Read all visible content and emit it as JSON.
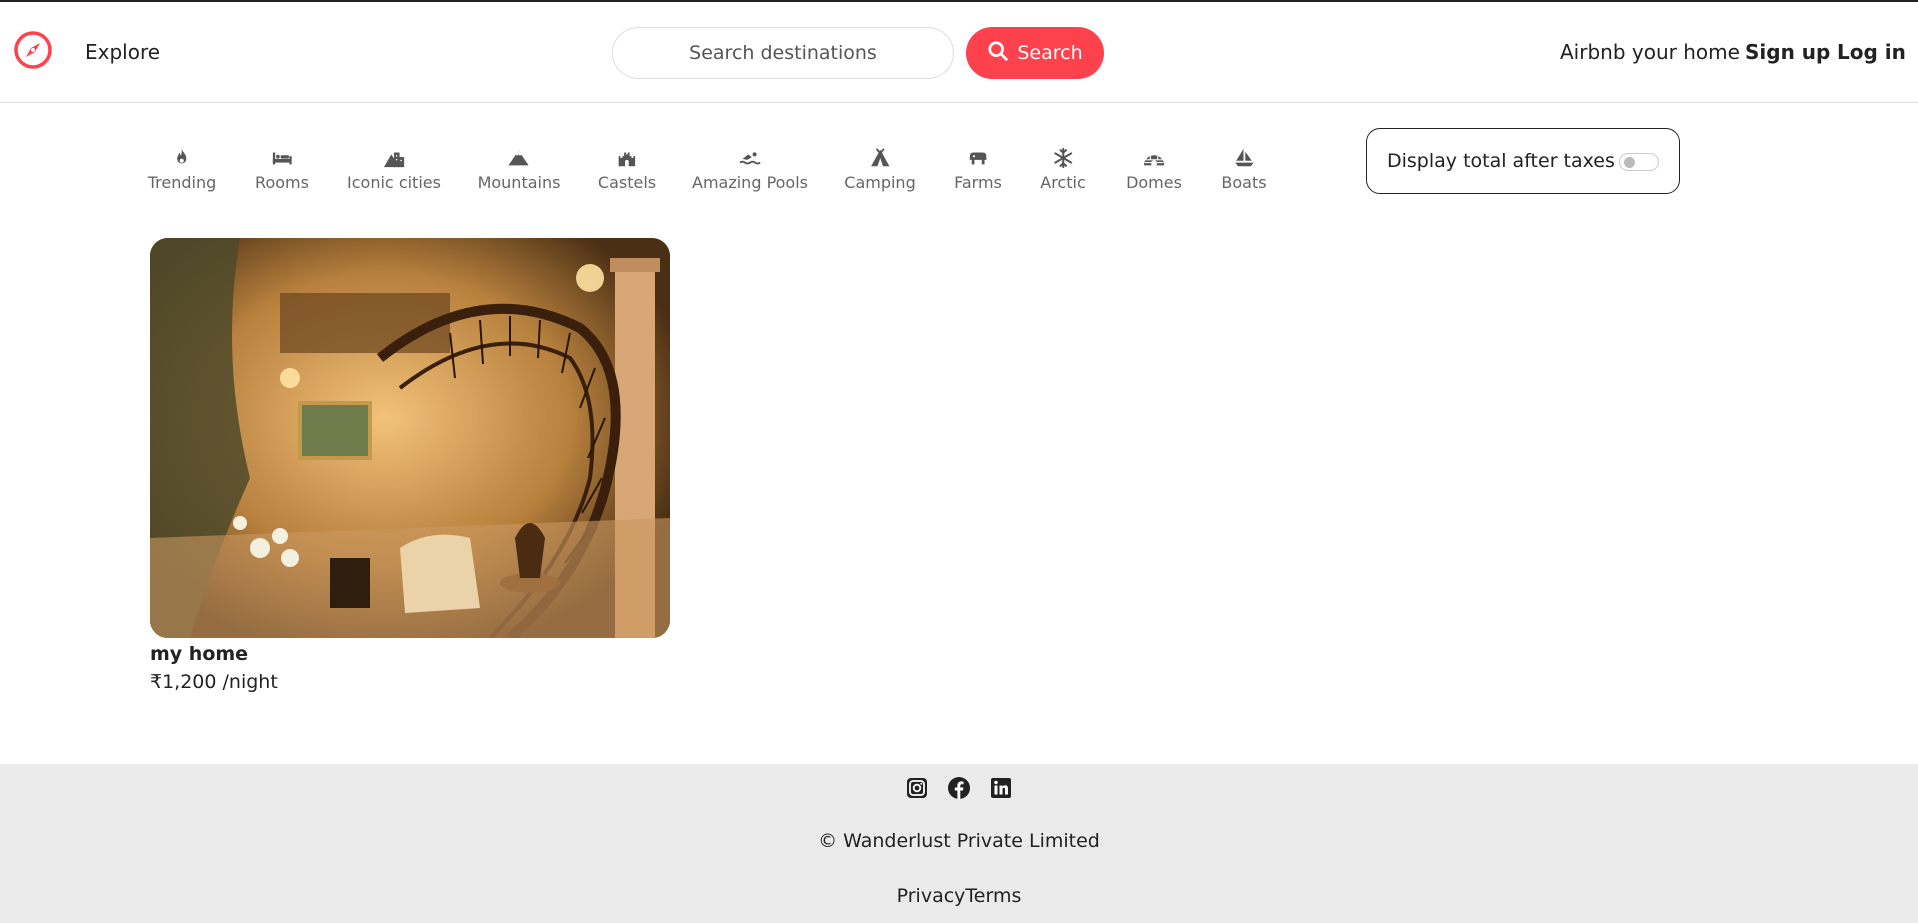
{
  "navbar": {
    "brand_icon": "compass-icon",
    "explore_label": "Explore",
    "search_placeholder": "Search destinations",
    "search_button_label": "Search",
    "host_label": "Airbnb your home",
    "signup_label": "Sign up",
    "login_label": "Log in",
    "accent_color": "#fe424d"
  },
  "filters": [
    {
      "label": "Trending",
      "icon": "fire-icon"
    },
    {
      "label": "Rooms",
      "icon": "bed-icon"
    },
    {
      "label": "Iconic cities",
      "icon": "city-icon"
    },
    {
      "label": "Mountains",
      "icon": "mountain-icon"
    },
    {
      "label": "Castels",
      "icon": "castle-icon"
    },
    {
      "label": "Amazing Pools",
      "icon": "swimmer-icon"
    },
    {
      "label": "Camping",
      "icon": "tent-icon"
    },
    {
      "label": "Farms",
      "icon": "cow-icon"
    },
    {
      "label": "Arctic",
      "icon": "snowflake-icon"
    },
    {
      "label": "Domes",
      "icon": "igloo-icon"
    },
    {
      "label": "Boats",
      "icon": "sailboat-icon"
    }
  ],
  "tax_toggle": {
    "label": "Display total after taxes",
    "enabled": false
  },
  "listings": [
    {
      "title": "my home",
      "price": "₹1,200 /night"
    }
  ],
  "footer": {
    "social_icons": [
      "instagram-icon",
      "facebook-icon",
      "linkedin-icon"
    ],
    "copyright": "© Wanderlust Private Limited",
    "privacy_label": "Privacy",
    "terms_label": "Terms"
  }
}
